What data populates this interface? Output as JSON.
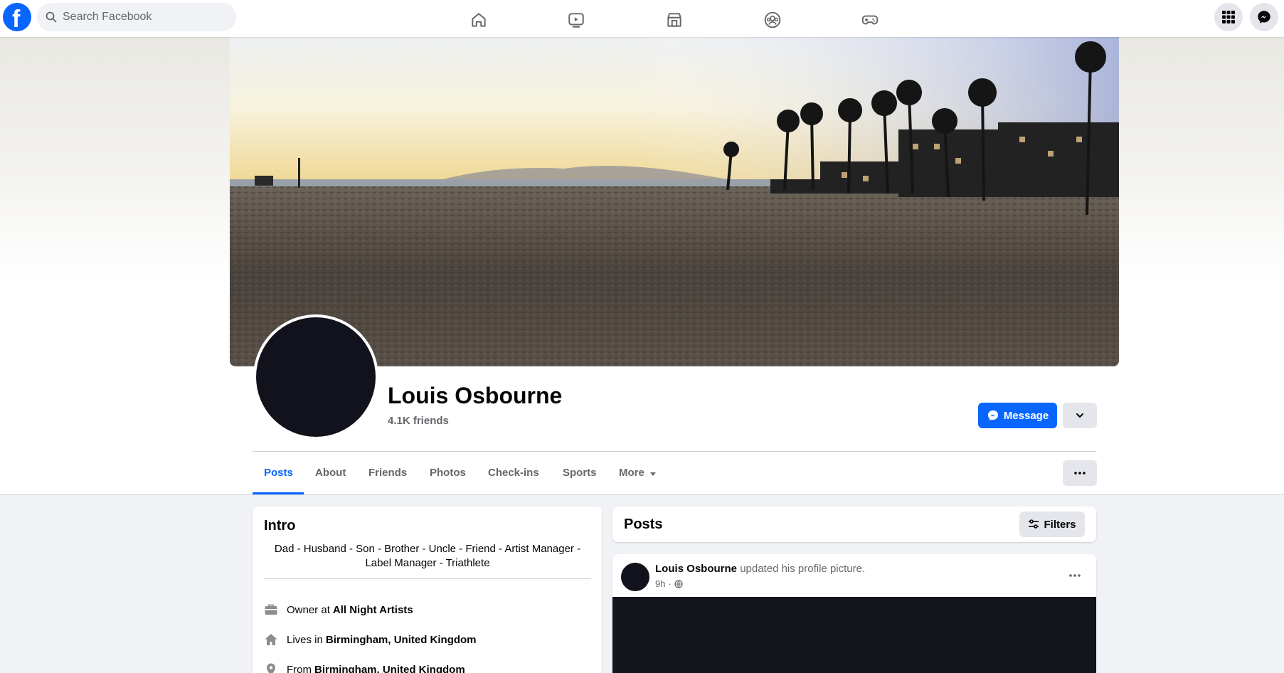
{
  "topbar": {
    "logo_letter": "f",
    "search_placeholder": "Search Facebook",
    "nav_icons": [
      "home-icon",
      "video-icon",
      "marketplace-icon",
      "groups-icon",
      "gaming-icon"
    ],
    "right_icons": [
      "menu-grid-icon",
      "messenger-icon"
    ]
  },
  "colors": {
    "accent": "#0866ff",
    "page_bg": "#f0f2f5",
    "secondary_text": "#65676b"
  },
  "profile": {
    "name": "Louis Osbourne",
    "friends": "4.1K friends",
    "message_label": "Message"
  },
  "tabs": {
    "items": [
      {
        "label": "Posts",
        "active": true
      },
      {
        "label": "About"
      },
      {
        "label": "Friends"
      },
      {
        "label": "Photos"
      },
      {
        "label": "Check-ins"
      },
      {
        "label": "Sports"
      },
      {
        "label": "More"
      }
    ]
  },
  "intro": {
    "title": "Intro",
    "bio": "Dad - Husband - Son - Brother - Uncle - Friend - Artist Manager - Label Manager - Triathlete",
    "rows": [
      {
        "icon": "briefcase-icon",
        "prefix": "Owner at",
        "value": "All Night Artists"
      },
      {
        "icon": "home-icon",
        "prefix": "Lives in",
        "value": "Birmingham, United Kingdom"
      },
      {
        "icon": "location-pin-icon",
        "prefix": "From",
        "value": "Birmingham, United Kingdom"
      }
    ]
  },
  "posts": {
    "title": "Posts",
    "filters_label": "Filters",
    "post": {
      "author": "Louis Osbourne",
      "action": "updated his profile picture.",
      "time": "9h",
      "separator": "·",
      "privacy_icon": "globe-icon"
    }
  }
}
